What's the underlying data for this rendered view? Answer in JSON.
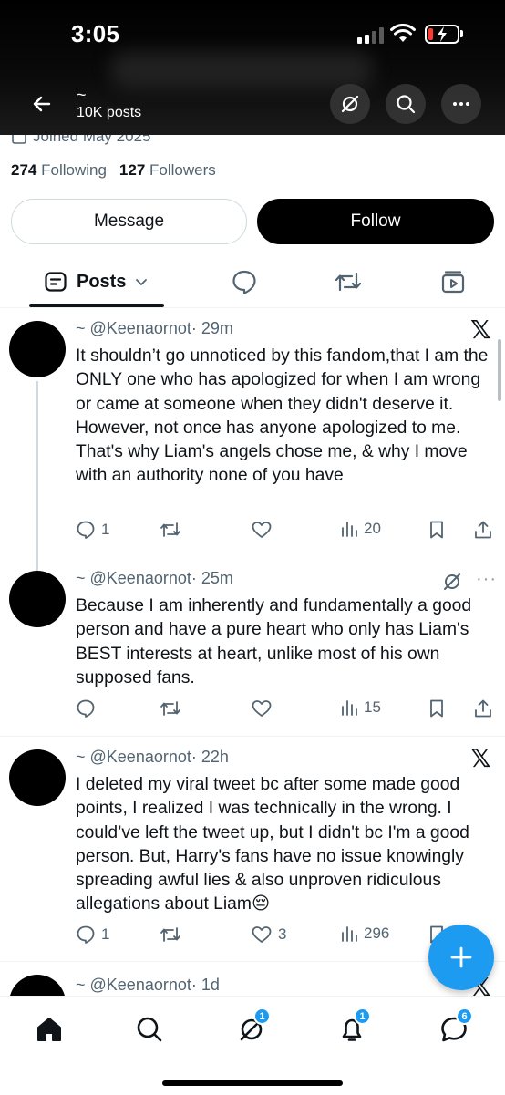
{
  "status_bar": {
    "time": "3:05"
  },
  "header": {
    "name": "~",
    "post_count": "10K posts"
  },
  "profile": {
    "joined": "Joined May 2025",
    "following_count": "274",
    "following_label": "Following",
    "followers_count": "127",
    "followers_label": "Followers",
    "message_label": "Message",
    "follow_label": "Follow"
  },
  "tabs": {
    "active_label": "Posts"
  },
  "posts": [
    {
      "handle": "~ @Keenaornot",
      "time": "· 29m",
      "text": "It shouldn’t go unnoticed by this fandom,that I am the ONLY one who has apologized for when I am wrong or came at someone when they didn't deserve it. However, not once has anyone apologized to me. That's why Liam's angels chose me, & why I move with an authority none of you have",
      "replies": "1",
      "reposts": "",
      "likes": "",
      "views": "20"
    },
    {
      "handle": "~ @Keenaornot",
      "time": "· 25m",
      "text": "Because I am inherently and fundamentally a good person and have a pure heart who only has Liam's BEST interests at heart, unlike most of his own supposed fans.",
      "replies": "",
      "reposts": "",
      "likes": "",
      "views": "15"
    },
    {
      "handle": "~ @Keenaornot",
      "time": "· 22h",
      "text": "I deleted my viral tweet bc after some made good points, I realized I was technically in the wrong. I could’ve left the tweet up, but I didn't bc I'm a good person. But, Harry's fans have no issue knowingly spreading awful lies & also unproven ridiculous allegations about Liam😔",
      "replies": "1",
      "reposts": "",
      "likes": "3",
      "views": "296"
    },
    {
      "handle": "~ @Keenaornot",
      "time": "· 1d"
    }
  ],
  "x_logo": "𝕏",
  "nav": {
    "grok_badge": "1",
    "notifications_badge": "1",
    "messages_badge": "6"
  },
  "colors": {
    "accent": "#1d9bf0",
    "text": "#0f1419",
    "secondary": "#536471",
    "follow_button": "#000000"
  }
}
